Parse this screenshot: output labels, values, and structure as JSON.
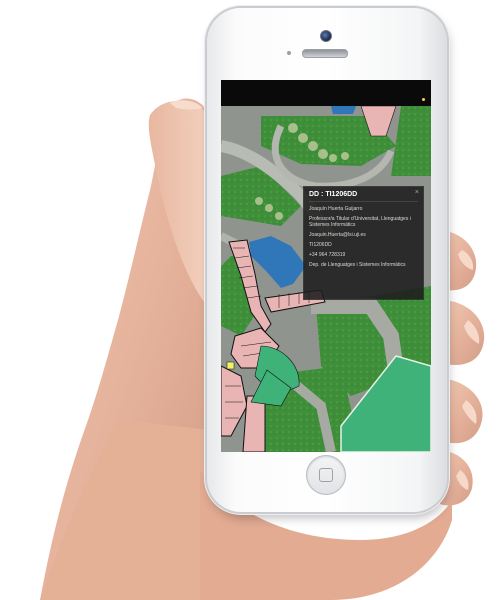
{
  "popup": {
    "title": "DD : TI1206DD",
    "close": "×",
    "name": "Joaquín Huerta Guijarro",
    "position": "Professor/a Titular d'Universitat, Llenguatges i Sistemes Informàtics",
    "email": "Joaquin.Huerta@lsi.uji.es",
    "room": "TI1206DD",
    "phone": "+34 964 728319",
    "department": "Dep. de Llenguatges i Sistemes Informàtics"
  },
  "colors": {
    "building_pink": "#e8b4b4",
    "building_outline": "#111111",
    "green_area": "#3fb27a",
    "lawn": "#3f8f3a",
    "water": "#2f77b8",
    "path_gray": "#a7aaa3",
    "highlight_yellow": "#f4f06a"
  },
  "icons": [
    "speaker-icon",
    "camera-icon",
    "home-button-icon",
    "close-icon"
  ]
}
